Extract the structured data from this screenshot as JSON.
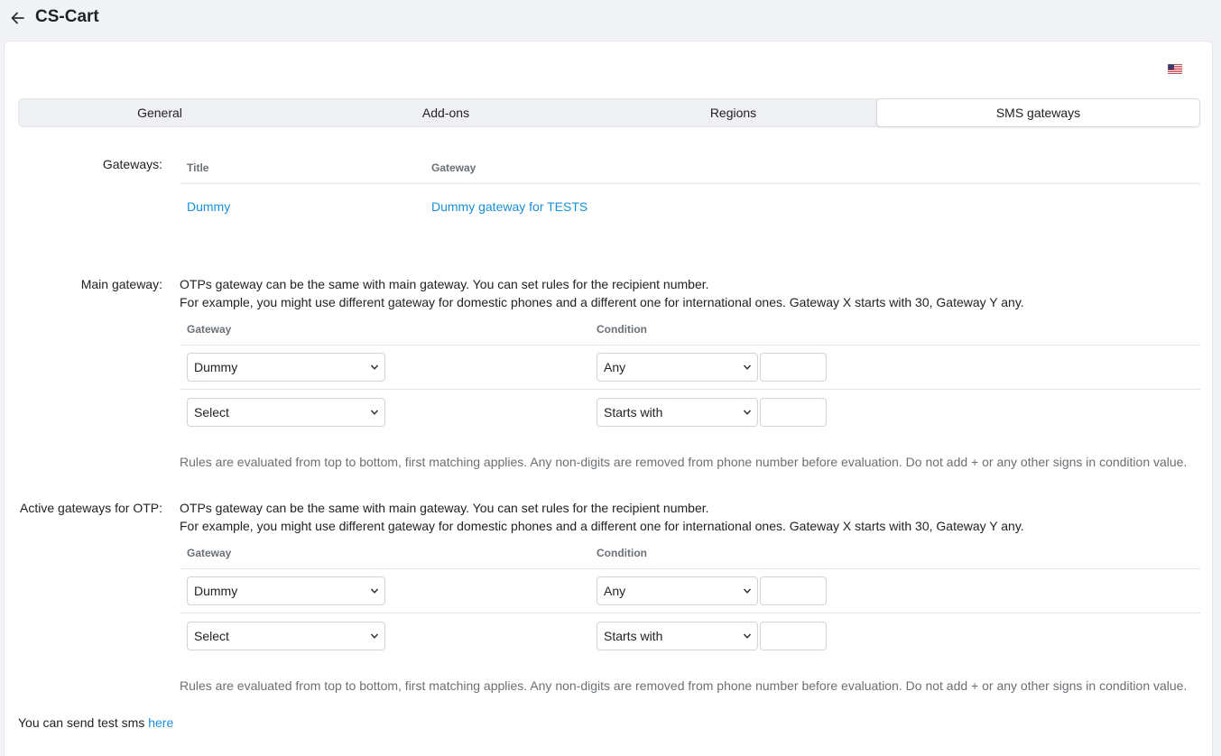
{
  "header": {
    "title": "CS-Cart"
  },
  "tabs": [
    {
      "label": "General"
    },
    {
      "label": "Add-ons"
    },
    {
      "label": "Regions"
    },
    {
      "label": "SMS gateways"
    }
  ],
  "gateways": {
    "label": "Gateways:",
    "columns": [
      "Title",
      "Gateway"
    ],
    "rows": [
      {
        "title": "Dummy",
        "gateway": "Dummy gateway for TESTS"
      }
    ]
  },
  "main_gateway": {
    "label": "Main gateway:",
    "desc1": "OTPs gateway can be the same with main gateway. You can set rules for the recipient number.",
    "desc2": "For example, you might use different gateway for domestic phones and a different one for international ones. Gateway X starts with 30, Gateway Y any.",
    "columns": [
      "Gateway",
      "Condition"
    ],
    "rows": [
      {
        "gateway": "Dummy",
        "condition": "Any",
        "value": ""
      },
      {
        "gateway": "Select",
        "condition": "Starts with",
        "value": ""
      }
    ],
    "hint": "Rules are evaluated from top to bottom, first matching applies. Any non-digits are removed from phone number before evaluation. Do not add + or any other signs in condition value."
  },
  "otp_gateways": {
    "label": "Active gateways for OTP:",
    "desc1": "OTPs gateway can be the same with main gateway. You can set rules for the recipient number.",
    "desc2": "For example, you might use different gateway for domestic phones and a different one for international ones. Gateway X starts with 30, Gateway Y any.",
    "columns": [
      "Gateway",
      "Condition"
    ],
    "rows": [
      {
        "gateway": "Dummy",
        "condition": "Any",
        "value": ""
      },
      {
        "gateway": "Select",
        "condition": "Starts with",
        "value": ""
      }
    ],
    "hint": "Rules are evaluated from top to bottom, first matching applies. Any non-digits are removed from phone number before evaluation. Do not add + or any other signs in condition value."
  },
  "footer": {
    "text": "You can send test sms ",
    "link": "here"
  },
  "icons": {
    "back": "arrow-left-icon",
    "flag": "us-flag-icon",
    "chevron": "chevron-down-icon"
  },
  "colors": {
    "link": "#1a8fd8",
    "background": "#f2f3f6",
    "panel": "#ffffff"
  }
}
